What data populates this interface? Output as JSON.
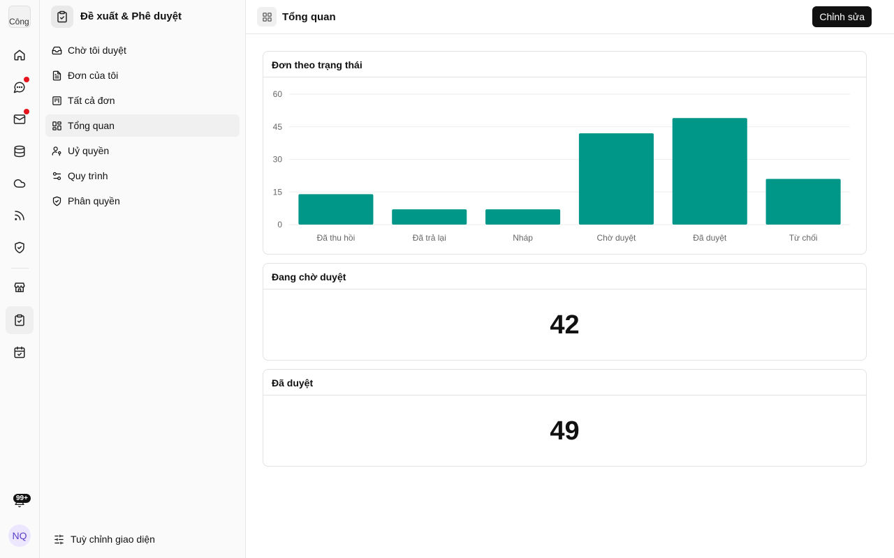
{
  "rail": {
    "logo_text": "Công",
    "items": [
      {
        "icon": "home-icon"
      },
      {
        "icon": "chat-icon",
        "has_dot": true
      },
      {
        "icon": "mail-icon",
        "has_dot": true
      },
      {
        "icon": "database-icon"
      },
      {
        "icon": "cloud-icon"
      },
      {
        "icon": "rss-icon"
      },
      {
        "icon": "shield-check-icon"
      },
      {
        "icon": "store-icon"
      },
      {
        "icon": "clipboard-check-icon",
        "active": true
      },
      {
        "icon": "calendar-check-icon"
      }
    ],
    "notification_badge": "99+",
    "avatar_initials": "NQ",
    "accent_dot": "#e5141c"
  },
  "sidebar": {
    "title": "Đề xuất & Phê duyệt",
    "items": [
      {
        "label": "Chờ tôi duyệt",
        "icon": "inbox-icon"
      },
      {
        "label": "Đơn của tôi",
        "icon": "file-text-icon"
      },
      {
        "label": "Tất cả đơn",
        "icon": "kanban-icon"
      },
      {
        "label": "Tổng quan",
        "icon": "layout-grid-icon",
        "active": true
      },
      {
        "label": "Uỷ quyền",
        "icon": "user-key-icon"
      },
      {
        "label": "Quy trình",
        "icon": "workflow-icon"
      },
      {
        "label": "Phân quyền",
        "icon": "shield-icon"
      }
    ],
    "footer_label": "Tuỳ chỉnh giao diện"
  },
  "header": {
    "title": "Tổng quan",
    "edit_label": "Chỉnh sửa"
  },
  "cards": {
    "status_chart_title": "Đơn theo trạng thái",
    "pending_title": "Đang chờ duyệt",
    "pending_value": "42",
    "approved_title": "Đã duyệt",
    "approved_value": "49"
  },
  "chart_data": {
    "type": "bar",
    "categories": [
      "Đã thu hồi",
      "Đã trả lại",
      "Nháp",
      "Chờ duyệt",
      "Đã duyệt",
      "Từ chối"
    ],
    "values": [
      14,
      7,
      7,
      42,
      49,
      21
    ],
    "ylim": [
      0,
      60
    ],
    "yticks": [
      0,
      15,
      30,
      45,
      60
    ],
    "grid": true,
    "color": "#009688"
  }
}
